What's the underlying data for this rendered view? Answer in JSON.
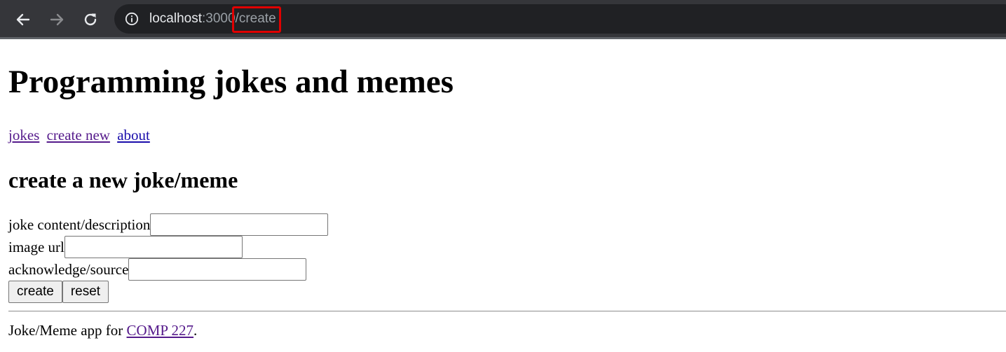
{
  "browser": {
    "url_host": "localhost",
    "url_port": ":3000",
    "url_path": "/create",
    "icons": [
      "back-arrow-icon",
      "forward-arrow-icon",
      "reload-icon",
      "info-icon"
    ]
  },
  "page": {
    "title": "Programming jokes and memes",
    "nav": {
      "jokes": "jokes",
      "create_new": "create new",
      "about": "about"
    },
    "section_title": "create a new joke/meme",
    "form": {
      "content_label": "joke content/description",
      "content_value": "",
      "image_label": "image url",
      "image_value": "",
      "source_label": "acknowledge/source",
      "source_value": "",
      "create_button": "create",
      "reset_button": "reset"
    },
    "footer": {
      "text_before": "Joke/Meme app for ",
      "link": "COMP 227",
      "text_after": "."
    }
  },
  "colors": {
    "chrome_bg": "#35363a",
    "omnibox_bg": "#202124",
    "highlight_box": "#e00000",
    "link": "#1a0dab",
    "visited_link": "#551a8b"
  }
}
